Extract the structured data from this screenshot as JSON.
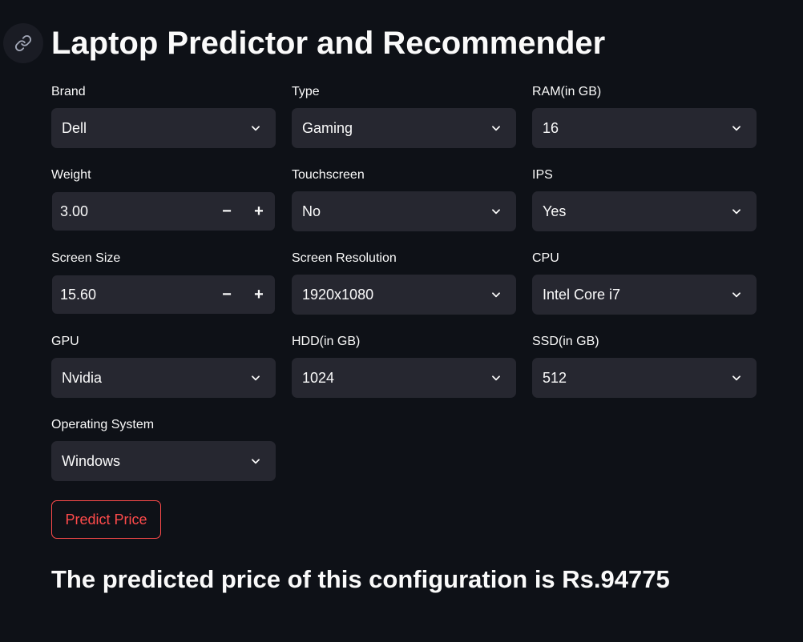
{
  "header": {
    "title": "Laptop Predictor and Recommender",
    "anchor_icon": "link-icon"
  },
  "fields": {
    "brand": {
      "label": "Brand",
      "value": "Dell"
    },
    "type": {
      "label": "Type",
      "value": "Gaming"
    },
    "ram": {
      "label": "RAM(in GB)",
      "value": "16"
    },
    "weight": {
      "label": "Weight",
      "value": "3.00",
      "minus": "−",
      "plus": "+"
    },
    "touchscreen": {
      "label": "Touchscreen",
      "value": "No"
    },
    "ips": {
      "label": "IPS",
      "value": "Yes"
    },
    "screen_size": {
      "label": "Screen Size",
      "value": "15.60",
      "minus": "−",
      "plus": "+"
    },
    "screen_resolution": {
      "label": "Screen Resolution",
      "value": "1920x1080"
    },
    "cpu": {
      "label": "CPU",
      "value": "Intel Core i7"
    },
    "gpu": {
      "label": "GPU",
      "value": "Nvidia"
    },
    "hdd": {
      "label": "HDD(in GB)",
      "value": "1024"
    },
    "ssd": {
      "label": "SSD(in GB)",
      "value": "512"
    },
    "os": {
      "label": "Operating System",
      "value": "Windows"
    }
  },
  "actions": {
    "predict_label": "Predict Price"
  },
  "result": {
    "text": "The predicted price of this configuration is Rs.94775"
  },
  "colors": {
    "background": "#0e1117",
    "widget": "#262730",
    "accent": "#ff4b4b",
    "text": "#fafafa"
  }
}
